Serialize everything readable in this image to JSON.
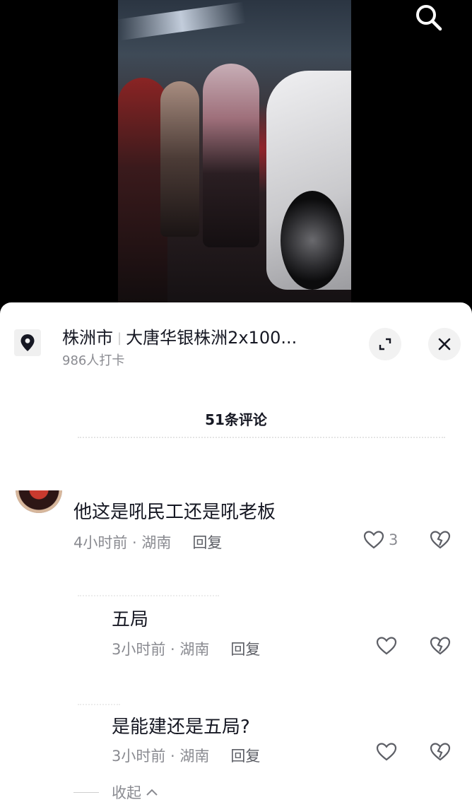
{
  "location": {
    "city": "株洲市",
    "place": "大唐华银株洲2x100...",
    "checkins": "986人打卡"
  },
  "comments_header": "51条评论",
  "comments": [
    {
      "text": "他这是吼民工还是吼老板",
      "time_region": "4小时前 · 湖南",
      "reply_label": "回复",
      "likes": "3"
    },
    {
      "text": "五局",
      "time_region": "3小时前 · 湖南",
      "reply_label": "回复"
    },
    {
      "text": "是能建还是五局?",
      "time_region": "3小时前 · 湖南",
      "reply_label": "回复"
    }
  ],
  "collapse_label": "收起",
  "icons": {
    "search": "search-icon",
    "location": "location-pin-icon",
    "expand": "expand-icon",
    "close": "close-icon",
    "like": "heart-icon",
    "dislike": "broken-heart-icon",
    "collapse": "chevron-up-icon"
  },
  "colors": {
    "text_primary": "#161823",
    "text_secondary": "#8a8b91",
    "sheet_bg": "#ffffff"
  }
}
